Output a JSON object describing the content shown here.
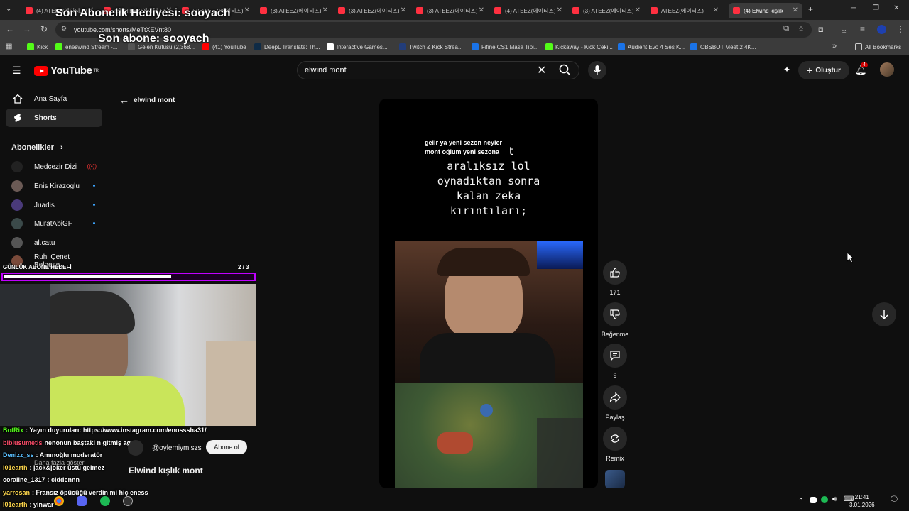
{
  "browser": {
    "tabs": [
      {
        "label": "(4) ATEEZ(에이티즈)"
      },
      {
        "label": "(3) ATEEZ(에이티즈)"
      },
      {
        "label": "(3) ATEEZ(에이티즈)"
      },
      {
        "label": "(3) ATEEZ(에이티즈)"
      },
      {
        "label": "(3) ATEEZ(에이티즈)"
      },
      {
        "label": "(3) ATEEZ(에이티즈)"
      },
      {
        "label": "(4) ATEEZ(에이티즈)"
      },
      {
        "label": "(3) ATEEZ(에이티즈)"
      },
      {
        "label": "ATEEZ(에이티즈)"
      },
      {
        "label": "(4) Elwind kışlık"
      }
    ],
    "url": "youtube.com/shorts/MeTtXEVnt80",
    "bookmarks": [
      "Kick",
      "eneswind Stream -...",
      "Gelen Kutusu (2,368...",
      "(41) YouTube",
      "DeepL Translate: Th...",
      "Interactive Games...",
      "Twitch & Kick Strea...",
      "Fifine CS1 Masa Tipi...",
      "Kickaway - Kick Çeki...",
      "Audient Evo 4 Ses K...",
      "OBSBOT Meet 2 4K...",
      "All Bookmarks"
    ],
    "colors": {
      "tab_bg": "#1f1f1f",
      "toolbar_bg": "#3b3b3b"
    }
  },
  "youtube": {
    "logo_text": "YouTube",
    "logo_region": "TR",
    "search_query": "elwind mont",
    "create_label": "Oluştur",
    "notification_count": "4",
    "sidebar": {
      "home": "Ana Sayfa",
      "shorts": "Shorts",
      "subscriptions_header": "Abonelikler",
      "subscriptions": [
        {
          "name": "Medcezir Dizi"
        },
        {
          "name": "Enis Kirazoglu"
        },
        {
          "name": "Juadis"
        },
        {
          "name": "MuratAbiGF"
        },
        {
          "name": "al.catu"
        },
        {
          "name": "Ruhi Çenet Belgese..."
        }
      ]
    },
    "back_label": "elwind mont",
    "short": {
      "caption": "... saat\naralıksız lol\noynadıktan sonra\nkalan zeka\nkırıntıları;",
      "overlay_text": "gelir ya yeni sezon neyler mont oğlum yeni sezona",
      "channel": "@oylemiymiszs",
      "subscribe": "Abone ol",
      "title": "Elwind kışlık mont",
      "more": "Daha fazla göster"
    },
    "actions": {
      "like_count": "171",
      "dislike_label": "Beğenme",
      "comment_count": "9",
      "share_label": "Paylaş",
      "remix_label": "Remix"
    }
  },
  "stream_overlay": {
    "gift_text": "Son Abonelik Hediyesi: sooyach",
    "last_sub_text": "Son abone: sooyach",
    "goal_label": "GÜNLÜK ABONE HEDEFİ",
    "goal_count": "2 / 3",
    "goal_progress": 0.67,
    "goal_color": "#c000ff",
    "chat": [
      {
        "user": "BotRix",
        "msg": ": Yayın duyuruları: https://www.instagram.com/enosssha31/",
        "color": "#53fc18"
      },
      {
        "user": "biblusumetis",
        "msg": "nenonun baştaki n gitmiş aga",
        "color": "#ff4d6a"
      },
      {
        "user": "Denizz_ss",
        "msg": ": Amınoğlu moderatör",
        "color": "#5bc0ff"
      },
      {
        "user": "l01earth",
        "msg": ": jack&joker üstü gelmez",
        "color": "#ffd84d"
      },
      {
        "user": "coraline_1317",
        "msg": ": ciddennn",
        "color": "#ffffff"
      },
      {
        "user": "yarrosan",
        "msg": ": Fransız öpücüğü verdin mi hiç eness",
        "color": "#ffd84d"
      },
      {
        "user": "l01earth",
        "msg": ": yinwar",
        "color": "#ffd84d"
      }
    ]
  },
  "taskbar": {
    "time": "21:41",
    "date": "3.01.2026"
  }
}
